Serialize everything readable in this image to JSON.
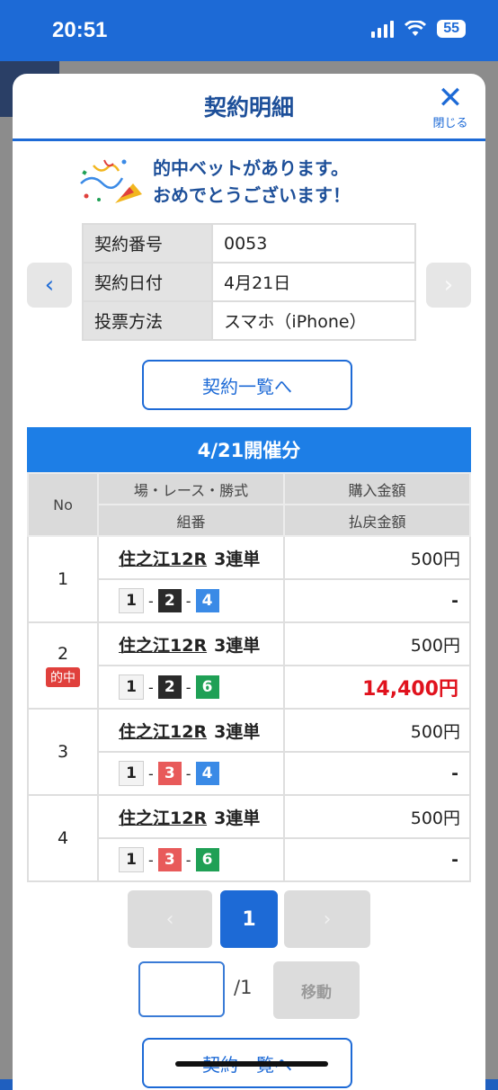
{
  "status": {
    "time": "20:51",
    "battery": "55"
  },
  "modal": {
    "title": "契約明細",
    "close_label": "閉じる"
  },
  "notice": {
    "line1": "的中ベットがあります。",
    "line2": "おめでとうございます！"
  },
  "contract": [
    {
      "label": "契約番号",
      "value": "0053"
    },
    {
      "label": "契約日付",
      "value": "4月21日"
    },
    {
      "label": "投票方法",
      "value": "スマホ（iPhone）"
    }
  ],
  "nav": {
    "prev": "‹",
    "next": "›"
  },
  "list_button": "契約一覧へ",
  "meeting_header": "4/21開催分",
  "table_headers": {
    "no": "No",
    "race": "場・レース・勝式",
    "combo": "組番",
    "purchase": "購入金額",
    "payout": "払戻金額"
  },
  "hit_label": "的中",
  "bets": [
    {
      "no": "1",
      "place": "住之江12R",
      "type": "3連単",
      "combo": [
        "1",
        "2",
        "4"
      ],
      "amount": "500円",
      "payout": "-",
      "hit": false
    },
    {
      "no": "2",
      "place": "住之江12R",
      "type": "3連単",
      "combo": [
        "1",
        "2",
        "6"
      ],
      "amount": "500円",
      "payout": "14,400円",
      "hit": true
    },
    {
      "no": "3",
      "place": "住之江12R",
      "type": "3連単",
      "combo": [
        "1",
        "3",
        "4"
      ],
      "amount": "500円",
      "payout": "-",
      "hit": false
    },
    {
      "no": "4",
      "place": "住之江12R",
      "type": "3連単",
      "combo": [
        "1",
        "3",
        "6"
      ],
      "amount": "500円",
      "payout": "-",
      "hit": false
    }
  ],
  "pagination": {
    "prev": "‹",
    "current": "1",
    "next": "›",
    "total": "/1",
    "move": "移動"
  },
  "icons": {
    "close": "close-icon",
    "popper": "party-popper-icon"
  },
  "colors": {
    "primary": "#1d6ad6",
    "hit": "#e0121d"
  }
}
